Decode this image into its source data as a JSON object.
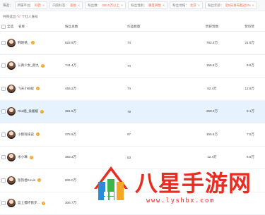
{
  "filters": [
    {
      "key": "筛选：",
      "value": "",
      "closable": false
    },
    {
      "key": "所属平台：",
      "value": "抖音",
      "closable": true
    },
    {
      "key": "内容标签：",
      "value": "美妆",
      "closable": true
    },
    {
      "key": "粉丝数：",
      "value": "300.0万以上",
      "closable": true
    },
    {
      "key": "粉丝性别：",
      "value": "重度男性",
      "closable": true
    },
    {
      "key": "粉丝地域：",
      "value": "北京",
      "closable": true
    },
    {
      "key": "粉丝年龄：",
      "value": "近5日发布超过2%",
      "closable": true
    }
  ],
  "summary": {
    "prefix": "共筛选出",
    "count": "5",
    "suffix": "个红人账号"
  },
  "table": {
    "headers": [
      "全选",
      "名称",
      "粉丝总数",
      "作品数量",
      "赞获赞数",
      "赞均赞"
    ],
    "rows": [
      {
        "name": "韩晓倩_",
        "fans": "822.9万",
        "works": "74",
        "likes": "762.4万",
        "liked": "21.6万",
        "highlight": false
      },
      {
        "name": "认真少女_颜九",
        "fans": "741.4万",
        "works": "74",
        "likes": "155.8万",
        "liked": "9.8万",
        "highlight": false
      },
      {
        "name": "飞天小蚂蚁",
        "fans": "455.2万",
        "works": "74",
        "likes": "62.4万",
        "liked": "12.9万",
        "highlight": false
      },
      {
        "name": "Rita姐_侯媛媛",
        "fans": "381.5万",
        "works": "79",
        "likes": "259.0万",
        "liked": "9.1万",
        "highlight": true
      },
      {
        "name": "小鹤科技说",
        "fans": "375.9万",
        "works": "67",
        "likes": "165.6万",
        "liked": "7.5万",
        "highlight": false
      },
      {
        "name": "米小琳",
        "fans": "383.3万",
        "works": "53",
        "likes": "12.4万",
        "liked": "6.9万",
        "highlight": false
      },
      {
        "name": "张凯君Kevin",
        "fans": "605.0万",
        "works": "",
        "likes": "",
        "liked": "",
        "highlight": false
      },
      {
        "name": "蓝上都坏我步...",
        "fans": "306.7万",
        "works": "",
        "likes": "",
        "liked": "",
        "highlight": false
      }
    ]
  },
  "watermark": {
    "title": "八星手游网",
    "url": "www.lyshbx.com"
  },
  "colors": {
    "accent": "#ff5a3c",
    "highlight_row": "#e6f2fd",
    "watermark": "#ea2b22"
  }
}
